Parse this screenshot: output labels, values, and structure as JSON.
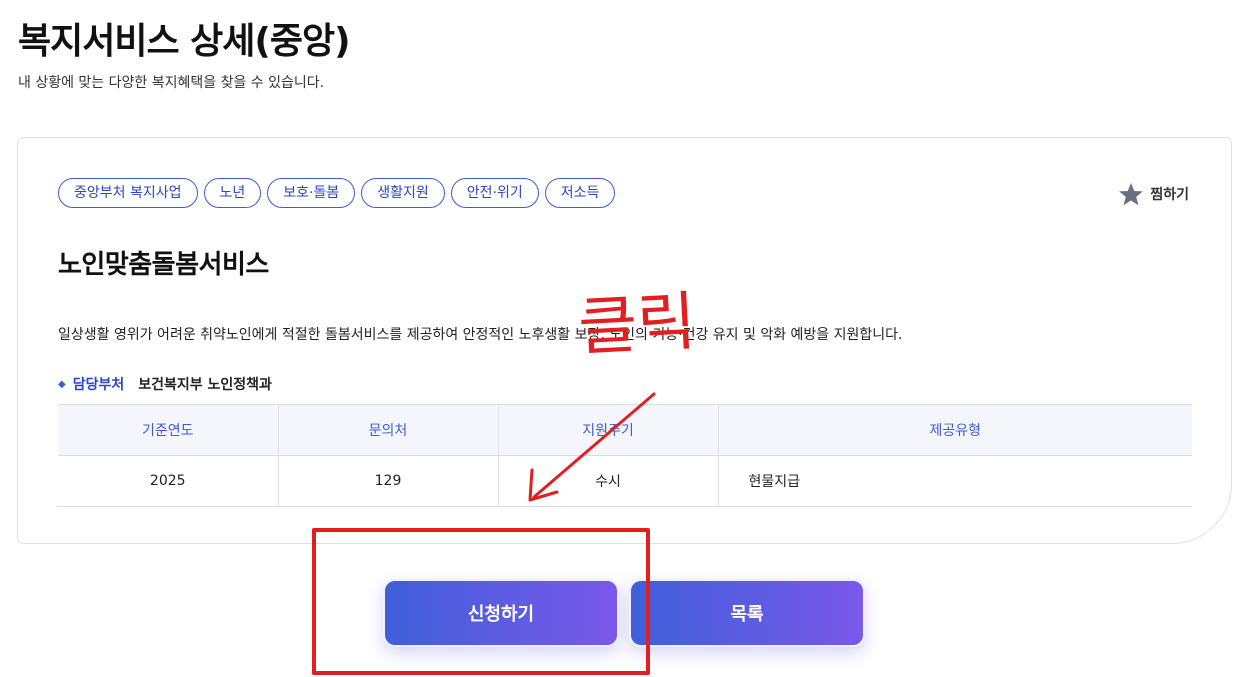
{
  "header": {
    "title": "복지서비스 상세(중앙)",
    "subtitle": "내 상황에 맞는 다양한 복지혜택을 찾을 수 있습니다."
  },
  "card": {
    "tags": [
      "중앙부처 복지사업",
      "노년",
      "보호·돌봄",
      "생활지원",
      "안전·위기",
      "저소득"
    ],
    "bookmark_label": "찜하기",
    "bookmark_icon": "star-icon",
    "service_title": "노인맞춤돌봄서비스",
    "description": "일상생활 영위가 어려운 취약노인에게 적절한 돌봄서비스를 제공하여 안정적인 노후생활 보장, 노인의 기능·건강 유지 및 악화 예방을 지원합니다.",
    "department": {
      "label": "담당부처",
      "value": "보건복지부 노인정책과"
    },
    "table": {
      "headers": [
        "기준연도",
        "문의처",
        "지원주기",
        "제공유형"
      ],
      "row": [
        "2025",
        "129",
        "수시",
        "현물지급"
      ]
    }
  },
  "buttons": {
    "apply_label": "신청하기",
    "list_label": "목록"
  },
  "annotation": {
    "text": "클릭",
    "color": "#e02020"
  },
  "colors": {
    "accent": "#3d5bd9",
    "button_gradient_start": "#3f5fd9",
    "button_gradient_end": "#7a58ea"
  }
}
